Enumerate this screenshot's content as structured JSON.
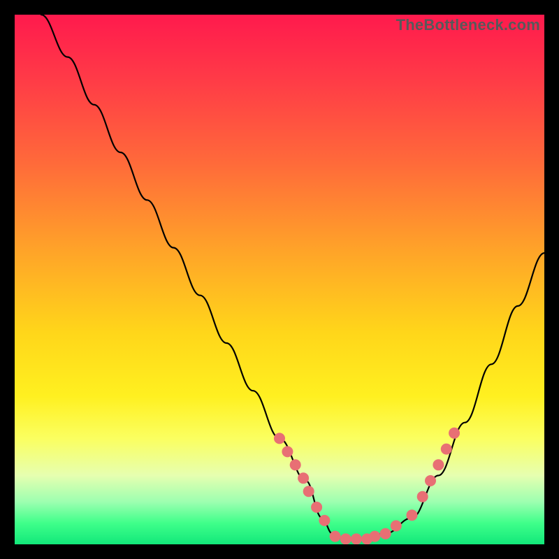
{
  "watermark": "TheBottleneck.com",
  "chart_data": {
    "type": "line",
    "title": "",
    "xlabel": "",
    "ylabel": "",
    "xlim": [
      0,
      100
    ],
    "ylim": [
      0,
      100
    ],
    "series": [
      {
        "name": "bottleneck-curve",
        "x": [
          5,
          10,
          15,
          20,
          25,
          30,
          35,
          40,
          45,
          50,
          55,
          58,
          60,
          62,
          65,
          70,
          75,
          80,
          85,
          90,
          95,
          100
        ],
        "values": [
          100,
          92,
          83,
          74,
          65,
          56,
          47,
          38,
          29,
          20,
          12,
          5,
          2,
          1,
          1,
          2,
          5,
          13,
          23,
          34,
          45,
          55
        ]
      }
    ],
    "markers": {
      "name": "highlight-dots",
      "color": "#e86f74",
      "points": [
        {
          "x": 50.0,
          "y": 20.0
        },
        {
          "x": 51.5,
          "y": 17.5
        },
        {
          "x": 53.0,
          "y": 15.0
        },
        {
          "x": 54.5,
          "y": 12.5
        },
        {
          "x": 55.5,
          "y": 10.0
        },
        {
          "x": 57.0,
          "y": 7.0
        },
        {
          "x": 58.5,
          "y": 4.5
        },
        {
          "x": 60.5,
          "y": 1.5
        },
        {
          "x": 62.5,
          "y": 1.0
        },
        {
          "x": 64.5,
          "y": 1.0
        },
        {
          "x": 66.5,
          "y": 1.0
        },
        {
          "x": 68.0,
          "y": 1.5
        },
        {
          "x": 70.0,
          "y": 2.0
        },
        {
          "x": 72.0,
          "y": 3.5
        },
        {
          "x": 75.0,
          "y": 5.5
        },
        {
          "x": 77.0,
          "y": 9.0
        },
        {
          "x": 78.5,
          "y": 12.0
        },
        {
          "x": 80.0,
          "y": 15.0
        },
        {
          "x": 81.5,
          "y": 18.0
        },
        {
          "x": 83.0,
          "y": 21.0
        }
      ]
    }
  }
}
